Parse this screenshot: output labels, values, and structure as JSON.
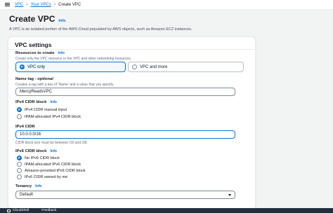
{
  "breadcrumbs": {
    "vpc": "VPC",
    "your_vpcs": "Your VPCs",
    "current": "Create VPC"
  },
  "page": {
    "title": "Create VPC",
    "info": "Info",
    "description": "A VPC is an isolated portion of the AWS Cloud populated by AWS objects, such as Amazon EC2 instances."
  },
  "settings": {
    "header": "VPC settings",
    "resources": {
      "label": "Resources to create",
      "info": "Info",
      "description": "Create only the VPC resource or the VPC and other networking resources.",
      "options": [
        "VPC only",
        "VPC and more"
      ],
      "selected": "VPC only"
    },
    "name_tag": {
      "label": "Name tag",
      "optional": "- optional",
      "description": "Creates a tag with a key of 'Name' and a value that you specify.",
      "value": "MercyReadsVPC"
    },
    "ipv4_block": {
      "label": "IPv4 CIDR block",
      "info": "Info",
      "options": [
        "IPv4 CIDR manual input",
        "IPAM-allocated IPv4 CIDR block"
      ],
      "selected": "IPv4 CIDR manual input"
    },
    "ipv4_cidr": {
      "label": "IPv4 CIDR",
      "value": "10.0.0.0/16",
      "constraint": "CIDR block size must be between /16 and /28."
    },
    "ipv6_block": {
      "label": "IPv6 CIDR block",
      "info": "Info",
      "options": [
        "No IPv6 CIDR block",
        "IPAM-allocated IPv6 CIDR block",
        "Amazon-provided IPv6 CIDR block",
        "IPv6 CIDR owned by me"
      ],
      "selected": "No IPv6 CIDR block"
    },
    "tenancy": {
      "label": "Tenancy",
      "info": "Info",
      "value": "Default"
    }
  },
  "footer": {
    "cloudshell": "CloudShell",
    "feedback": "Feedback"
  },
  "colors": {
    "accent": "#0972d3",
    "footer_bg": "#232f3e"
  }
}
